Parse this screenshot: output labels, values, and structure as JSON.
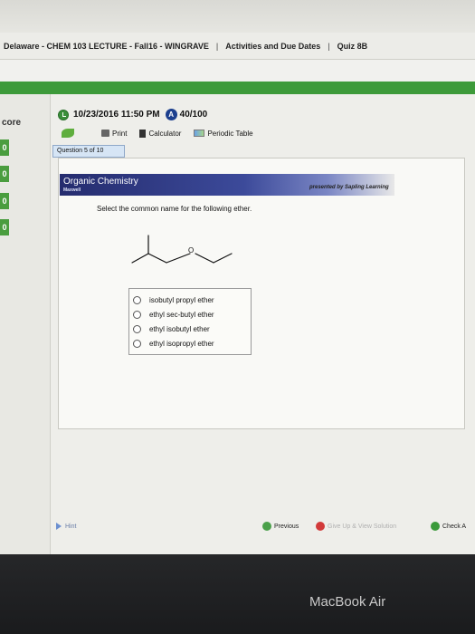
{
  "breadcrumb": {
    "course": "Delaware - CHEM 103 LECTURE - Fall16 - WINGRAVE",
    "section": "Activities and Due Dates",
    "assignment": "Quiz 8B",
    "separator": "|"
  },
  "sidebar": {
    "score_label": "core",
    "badges": [
      "0",
      "0",
      "0",
      "0"
    ]
  },
  "info": {
    "due_date": "10/23/2016 11:50 PM",
    "score": "40/100"
  },
  "toolbar": {
    "print": "Print",
    "calculator": "Calculator",
    "periodic_table": "Periodic Table"
  },
  "question": {
    "counter": "Question 5 of 10",
    "banner_title": "Organic Chemistry",
    "banner_sub": "Maxwell",
    "presented_by": "presented by Sapling Learning",
    "prompt": "Select the common name for the following ether.",
    "atom_label": "O",
    "choices": [
      "isobutyl propyl ether",
      "ethyl sec-butyl ether",
      "ethyl isobutyl ether",
      "ethyl isopropyl ether"
    ]
  },
  "footer": {
    "hint": "Hint",
    "previous": "Previous",
    "give_up": "Give Up & View Solution",
    "check": "Check A"
  },
  "device": {
    "label": "MacBook Air"
  },
  "colors": {
    "accent_green": "#3d9a3a",
    "banner_blue": "#252c6e"
  }
}
